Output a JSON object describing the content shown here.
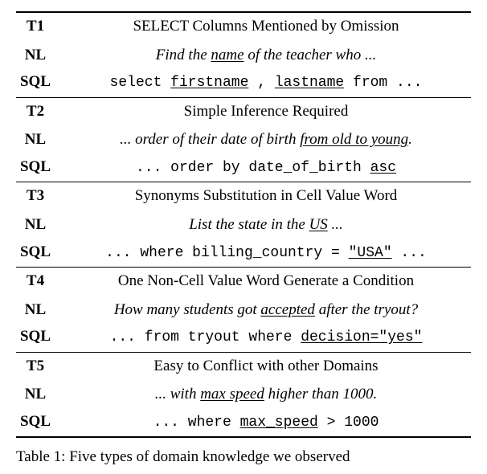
{
  "rows": [
    {
      "tlabel": "T1",
      "title_pre": "SELECT Columns Mentioned by Omission",
      "title_ul": "",
      "title_post": "",
      "nl_pre": "Find the ",
      "nl_ul": "name",
      "nl_post": " of the teacher who ...",
      "sql_pre": "select ",
      "sql_ul1": "firstname",
      "sql_mid": " , ",
      "sql_ul2": "lastname",
      "sql_post": " from ..."
    },
    {
      "tlabel": "T2",
      "title_pre": "Simple Inference Required",
      "title_ul": "",
      "title_post": "",
      "nl_pre": "... order of their date of birth ",
      "nl_ul": "from old to young",
      "nl_post": ".",
      "sql_pre": "... order by date_of_birth ",
      "sql_ul1": "asc",
      "sql_mid": "",
      "sql_ul2": "",
      "sql_post": ""
    },
    {
      "tlabel": "T3",
      "title_pre": "Synonyms Substitution in Cell Value Word",
      "title_ul": "",
      "title_post": "",
      "nl_pre": "List the state in the ",
      "nl_ul": "US",
      "nl_post": " ...",
      "sql_pre": "... where billing_country = ",
      "sql_ul1": "\"USA\"",
      "sql_mid": "",
      "sql_ul2": "",
      "sql_post": " ..."
    },
    {
      "tlabel": "T4",
      "title_pre": "One Non-Cell Value Word Generate a Condition",
      "title_ul": "",
      "title_post": "",
      "nl_pre": "How many students got ",
      "nl_ul": "accepted",
      "nl_post": " after the tryout?",
      "sql_pre": "... from tryout where ",
      "sql_ul1": "decision=\"yes\"",
      "sql_mid": "",
      "sql_ul2": "",
      "sql_post": ""
    },
    {
      "tlabel": "T5",
      "title_pre": "Easy to Conflict with other Domains",
      "title_ul": "",
      "title_post": "",
      "nl_pre": "... with ",
      "nl_ul": "max speed",
      "nl_post": " higher than 1000.",
      "sql_pre": "... where ",
      "sql_ul1": "max_speed",
      "sql_mid": "",
      "sql_ul2": "",
      "sql_post": " > 1000"
    }
  ],
  "labels": {
    "nl": "NL",
    "sql": "SQL"
  },
  "caption_pre": "Table 1: Five types of domain knowledge we observed"
}
